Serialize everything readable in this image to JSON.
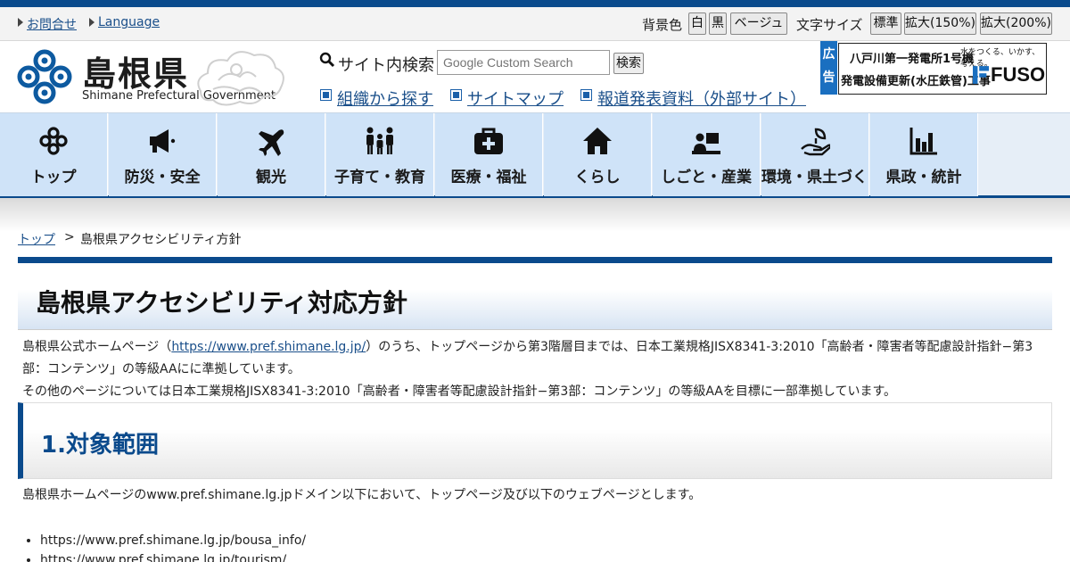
{
  "utility": {
    "contact": "お問合せ",
    "language": "Language",
    "bg_label": "背景色",
    "bg_white": "白",
    "bg_black": "黒",
    "bg_beige": "ベージュ",
    "font_label": "文字サイズ",
    "font_standard": "標準",
    "font_150": "拡大(150%)",
    "font_200": "拡大(200%)"
  },
  "header": {
    "logo_title": "島根県",
    "logo_subtitle": "Shimane Prefectural Government",
    "search_label": "サイト内検索",
    "search_placeholder": "Google Custom Search",
    "search_button": "検索",
    "links": [
      "組織から探す",
      "サイトマップ",
      "報道発表資料（外部サイト）"
    ],
    "ad_tag": "広告",
    "ad_line1": "八戸川第一発電所1号機",
    "ad_line2": "発電設備更新(水圧鉄管)工事",
    "ad_slogan": "水をつくる、いかす、考える。",
    "ad_brand": "FUSO"
  },
  "nav": {
    "items": [
      {
        "label": "トップ",
        "icon": "top-icon"
      },
      {
        "label": "防災・安全",
        "icon": "megaphone-icon"
      },
      {
        "label": "観光",
        "icon": "airplane-icon"
      },
      {
        "label": "子育て・教育",
        "icon": "family-icon"
      },
      {
        "label": "医療・福祉",
        "icon": "medical-bag-icon"
      },
      {
        "label": "くらし",
        "icon": "house-icon"
      },
      {
        "label": "しごと・産業",
        "icon": "worker-icon"
      },
      {
        "label": "環境・県土づくり",
        "icon": "hand-leaf-icon"
      },
      {
        "label": "県政・統計",
        "icon": "bar-chart-icon"
      }
    ]
  },
  "breadcrumb": {
    "top": "トップ",
    "separator": ">",
    "current": "島根県アクセシビリティ方針"
  },
  "main": {
    "title": "島根県アクセシビリティ対応方針",
    "p1_before": "島根県公式ホームページ（",
    "p1_link": "https://www.pref.shimane.lg.jp/",
    "p1_after": "）のうち、トップページから第3階層目までは、日本工業規格JISX8341-3:2010「高齢者・障害者等配慮設計指針−第3部：コンテンツ」の等級AAにに準拠しています。",
    "p2": "その他のページについては日本工業規格JISX8341-3:2010「高齢者・障害者等配慮設計指針−第3部：コンテンツ」の等級AAを目標に一部準拠しています。",
    "section1_heading": "1.対象範囲",
    "section1_text": "島根県ホームページのwww.pref.shimane.lg.jpドメイン以下において、トップページ及び以下のウェブページとします。",
    "section1_list": [
      "https://www.pref.shimane.lg.jp/bousa_info/",
      "https://www.pref.shimane.lg.jp/tourism/"
    ]
  },
  "colors": {
    "brand_navy": "#0a4a8c",
    "nav_bg": "#cfe3f8",
    "link": "#1a4f8a"
  }
}
